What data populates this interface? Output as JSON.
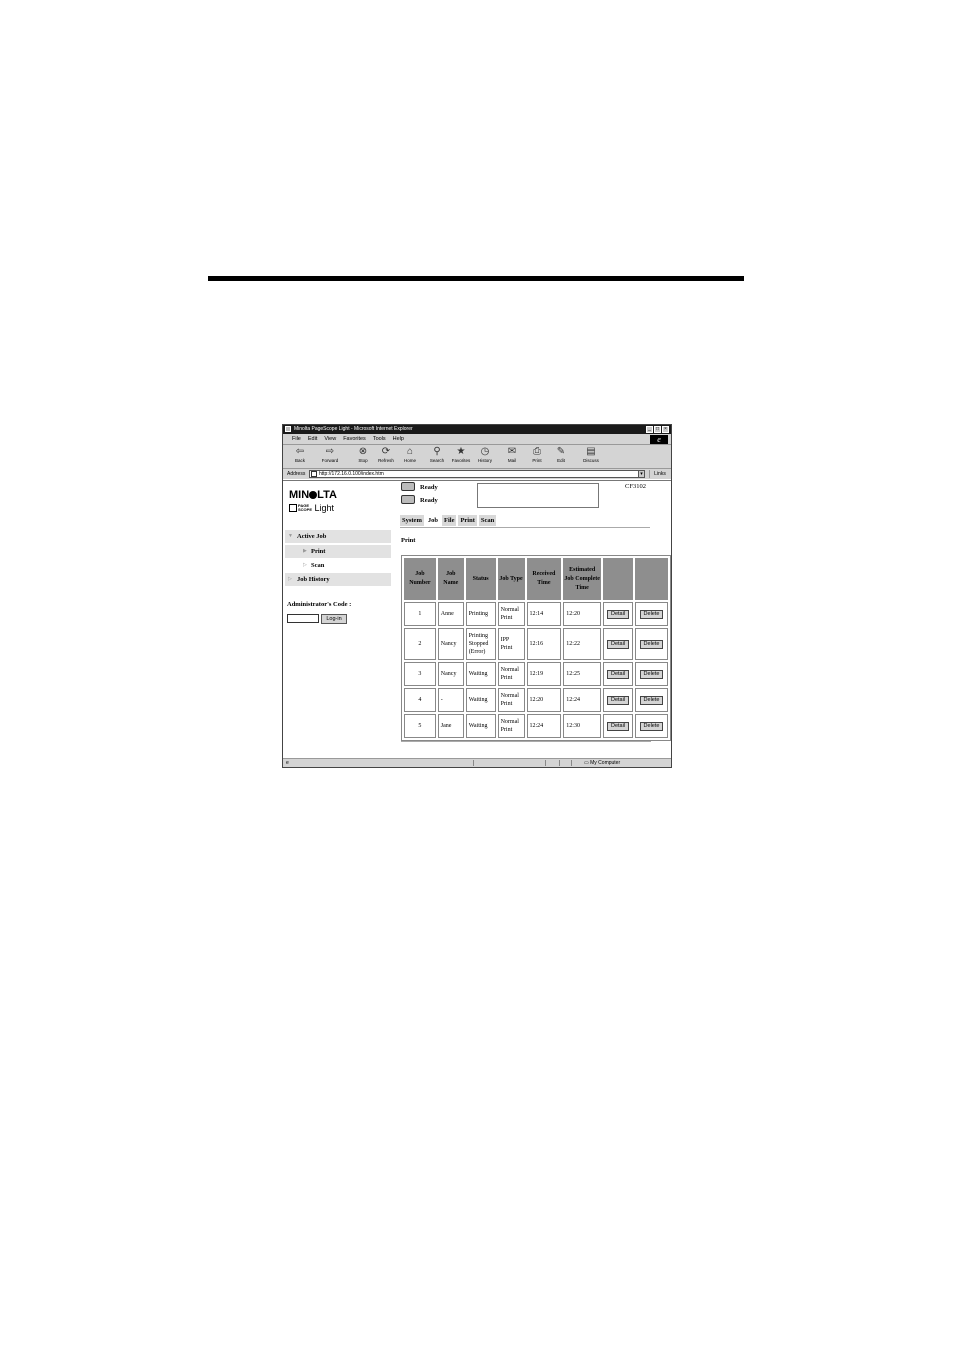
{
  "window": {
    "title": "Minolta PageScope Light - Microsoft Internet Explorer"
  },
  "menu": [
    "File",
    "Edit",
    "View",
    "Favorites",
    "Tools",
    "Help"
  ],
  "toolbar": [
    {
      "label": "Back",
      "icon": "back-arrow-icon",
      "glyph": "⇦"
    },
    {
      "label": "Forward",
      "icon": "forward-arrow-icon",
      "glyph": "⇨"
    },
    {
      "label": "Stop",
      "icon": "stop-icon",
      "glyph": "⊗"
    },
    {
      "label": "Refresh",
      "icon": "refresh-icon",
      "glyph": "⟳"
    },
    {
      "label": "Home",
      "icon": "home-icon",
      "glyph": "⌂"
    },
    {
      "label": "Search",
      "icon": "search-icon",
      "glyph": "⚲"
    },
    {
      "label": "Favorites",
      "icon": "favorites-icon",
      "glyph": "★"
    },
    {
      "label": "History",
      "icon": "history-icon",
      "glyph": "◷"
    },
    {
      "label": "Mail",
      "icon": "mail-icon",
      "glyph": "✉"
    },
    {
      "label": "Print",
      "icon": "print-icon",
      "glyph": "⎙"
    },
    {
      "label": "Edit",
      "icon": "edit-icon",
      "glyph": "✎"
    },
    {
      "label": "Discuss",
      "icon": "discuss-icon",
      "glyph": "▤"
    }
  ],
  "address": {
    "label": "Address",
    "url": "http://172.16.0.100/index.htm",
    "links": "Links"
  },
  "logo": {
    "brand_before": "MIN",
    "brand_after": "LTA",
    "page": "PAGE",
    "scope": "SCOPE",
    "light": "Light"
  },
  "sidebar": {
    "items": [
      {
        "label": "Active Job"
      },
      {
        "label": "Print"
      },
      {
        "label": "Scan"
      },
      {
        "label": "Job History"
      }
    ],
    "admin_label": "Administrator's Code :",
    "login_button": "Log-in"
  },
  "status": {
    "printer": "Ready",
    "scanner": "Ready",
    "model": "CF3102"
  },
  "tabs": [
    "System",
    "Job",
    "File",
    "Print",
    "Scan"
  ],
  "section_title": "Print",
  "table": {
    "headers": [
      "Job Number",
      "Job Name",
      "Status",
      "Job Type",
      "Received Time",
      "Estimated Job Complete Time",
      "",
      ""
    ],
    "rows": [
      {
        "num": "1",
        "name": "Anne",
        "status": "Printing",
        "type": "Normal Print",
        "received": "12:14",
        "estimated": "12:20"
      },
      {
        "num": "2",
        "name": "Nancy",
        "status": "Printing Stopped (Error)",
        "type": "IPP Print",
        "received": "12:16",
        "estimated": "12:22"
      },
      {
        "num": "3",
        "name": "Nancy",
        "status": "Waiting",
        "type": "Normal Print",
        "received": "12:19",
        "estimated": "12:25"
      },
      {
        "num": "4",
        "name": "-",
        "status": "Waiting",
        "type": "Normal Print",
        "received": "12:20",
        "estimated": "12:24"
      },
      {
        "num": "5",
        "name": "Jane",
        "status": "Waiting",
        "type": "Normal Print",
        "received": "12:24",
        "estimated": "12:30"
      }
    ],
    "detail_label": "Detail",
    "delete_label": "Delete"
  },
  "statusbar": {
    "zone": "My Computer"
  }
}
